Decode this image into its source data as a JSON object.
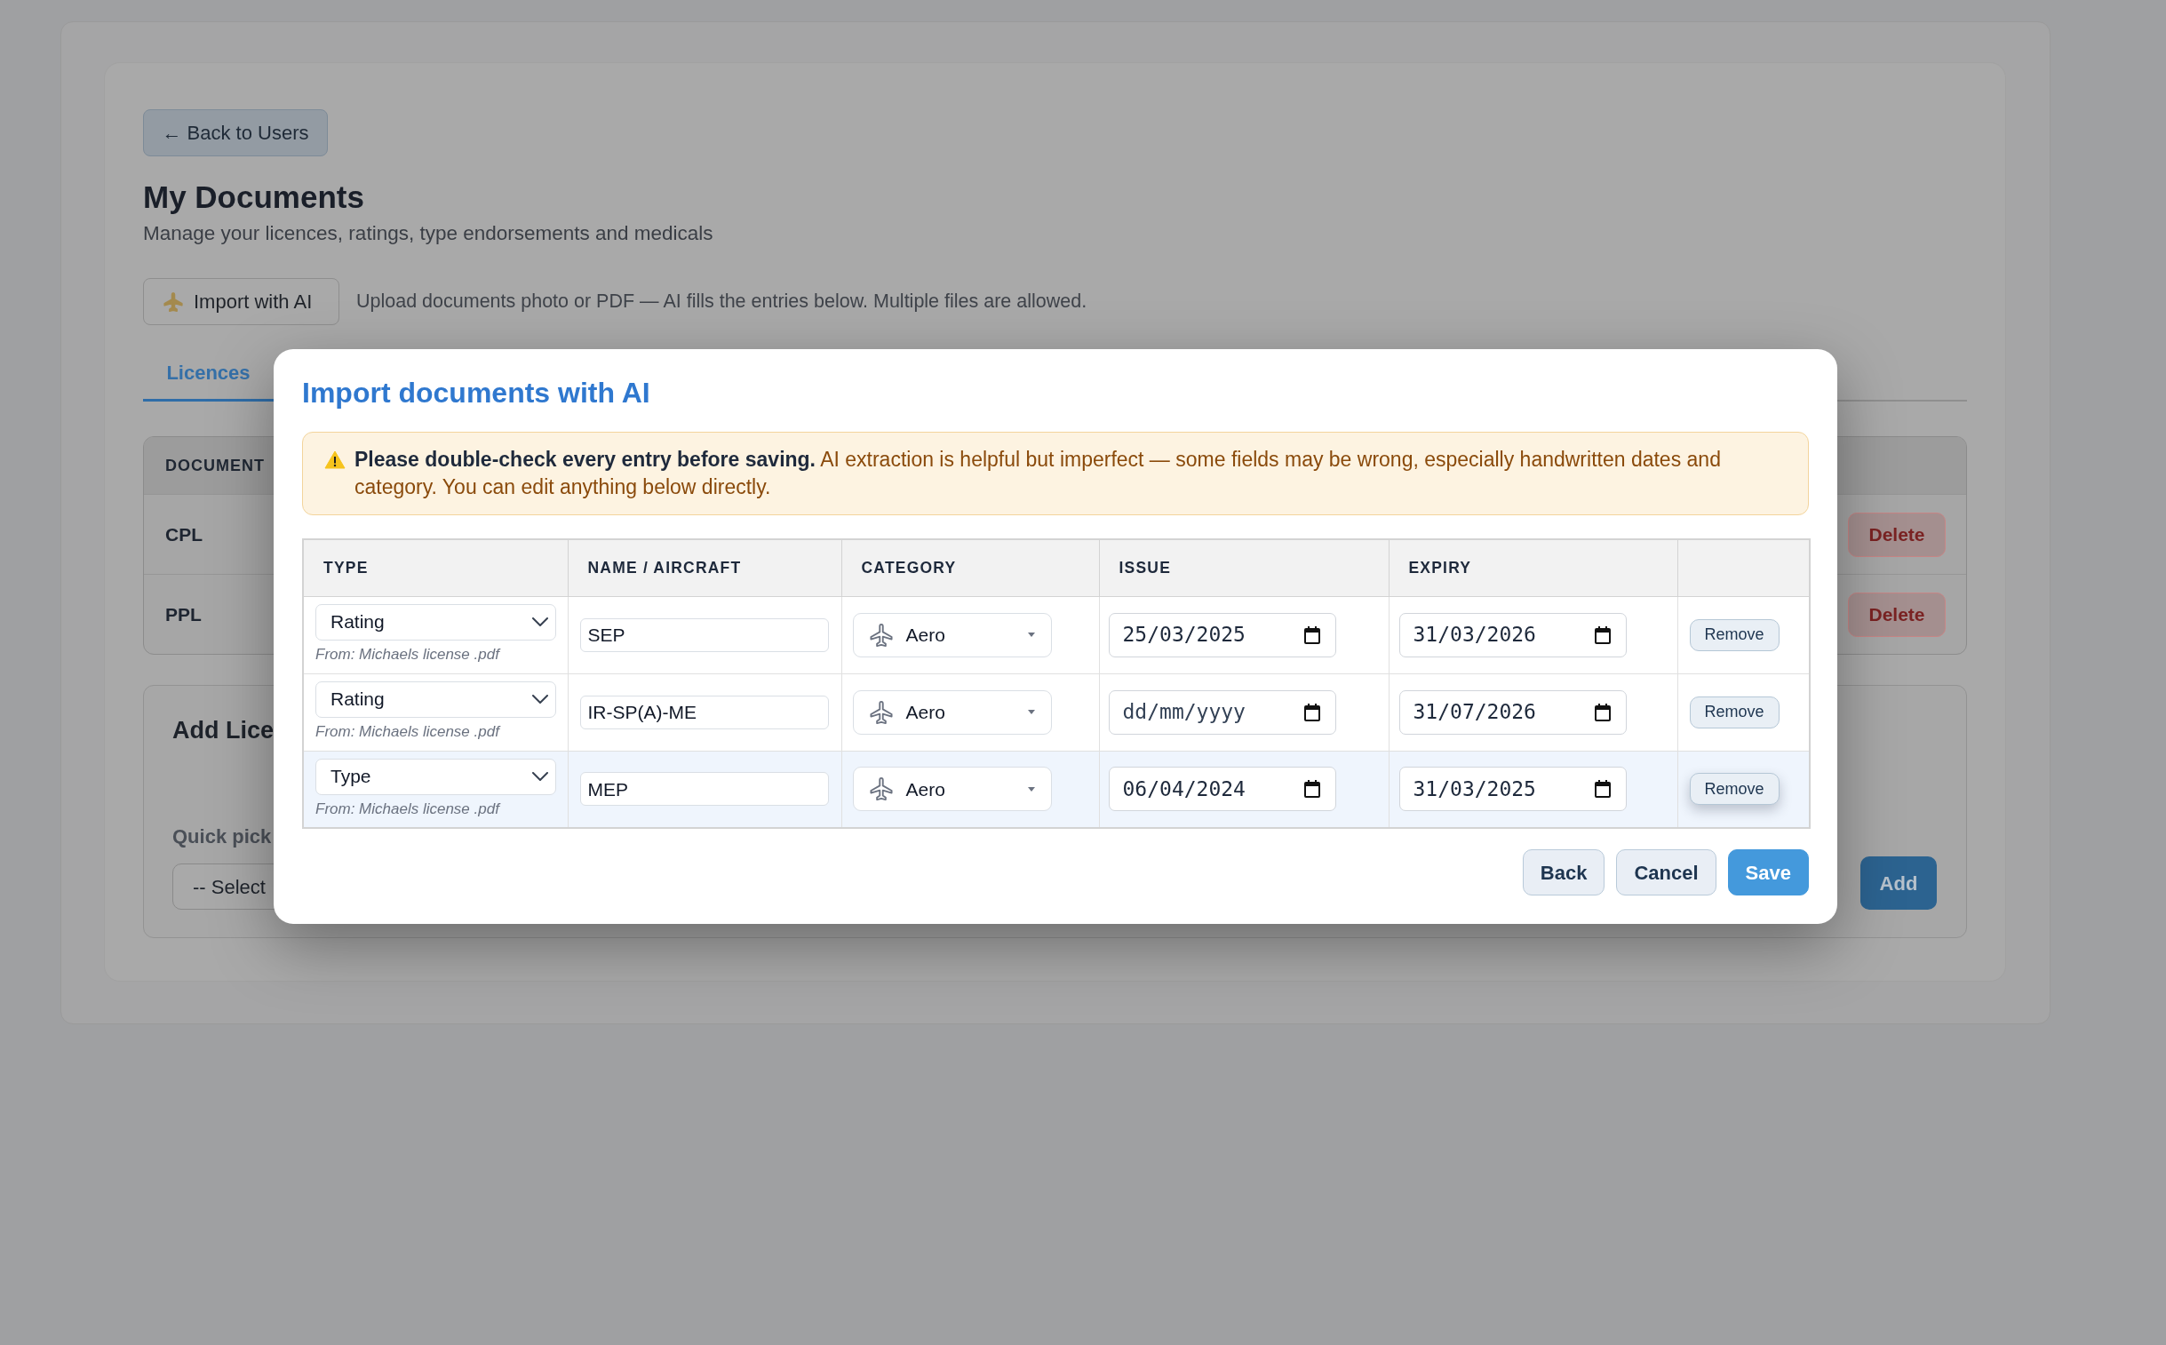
{
  "page": {
    "back_button": "← Back to Users",
    "title": "My Documents",
    "subtitle": "Manage your licences, ratings, type endorsements and medicals",
    "import_button": "Import with AI",
    "import_hint": "Upload documents photo or PDF — AI fills the entries below. Multiple files are allowed.",
    "tabs": [
      {
        "label": "Licences",
        "selected": true
      }
    ],
    "documents_table": {
      "columns": [
        "DOCUMENT"
      ],
      "rows": [
        {
          "document": "CPL",
          "action": "Delete"
        },
        {
          "document": "PPL",
          "action": "Delete"
        }
      ]
    },
    "add_card": {
      "title": "Add Lice",
      "quick_pick_label": "Quick pick",
      "quick_pick_value": "-- Select",
      "add_button": "Add"
    }
  },
  "dialog": {
    "title": "Import documents with AI",
    "warning": "**Please double-check every entry before saving.** AI extraction is helpful but imperfect — some fields may be wrong, especially handwritten dates and category. You can edit anything below directly.",
    "table": {
      "columns": [
        "TYPE",
        "NAME / AIRCRAFT",
        "CATEGORY",
        "ISSUE",
        "EXPIRY"
      ],
      "rows": [
        {
          "highlighted": false,
          "type": "Rating",
          "source": "From: Michaels license .pdf",
          "name": "SEP",
          "category": "Aero",
          "issue": {
            "value": "25/03/2025"
          },
          "expiry": {
            "value": "31/03/2026"
          },
          "action": "Remove"
        },
        {
          "highlighted": false,
          "type": "Rating",
          "source": "From: Michaels license .pdf",
          "name": "IR-SP(A)-ME",
          "category": "Aero",
          "issue": {
            "placeholder": "dd/mm/yyyy"
          },
          "expiry": {
            "value": "31/07/2026"
          },
          "action": "Remove"
        },
        {
          "highlighted": true,
          "type": "Type",
          "source": "From: Michaels license .pdf",
          "name": "MEP",
          "category": "Aero",
          "issue": {
            "value": "06/04/2024"
          },
          "expiry": {
            "value": "31/03/2025"
          },
          "action": "Remove"
        }
      ]
    },
    "buttons": [
      {
        "label": "Back",
        "kind": "secondary"
      },
      {
        "label": "Cancel",
        "kind": "secondary"
      },
      {
        "label": "Save",
        "kind": "primary"
      }
    ]
  }
}
